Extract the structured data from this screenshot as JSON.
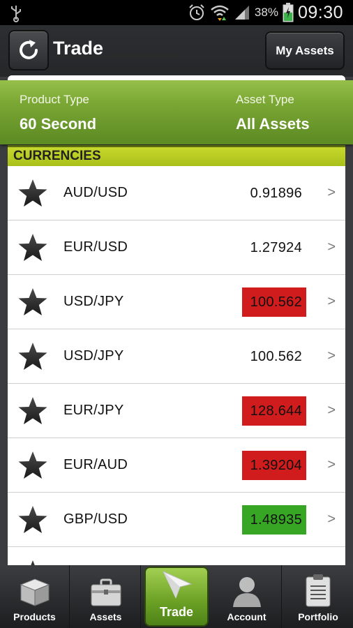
{
  "status_bar": {
    "battery_percent": "38%",
    "time": "09:30"
  },
  "header": {
    "title": "Trade",
    "my_assets_label": "My Assets"
  },
  "filters": {
    "product_type_label": "Product Type",
    "product_type_value": "60 Second",
    "asset_type_label": "Asset Type",
    "asset_type_value": "All Assets"
  },
  "section": {
    "title": "CURRENCIES"
  },
  "rows": [
    {
      "pair": "AUD/USD",
      "price": "0.91896",
      "state": "neutral"
    },
    {
      "pair": "EUR/USD",
      "price": "1.27924",
      "state": "neutral"
    },
    {
      "pair": "USD/JPY",
      "price": "100.562",
      "state": "down"
    },
    {
      "pair": "USD/JPY",
      "price": "100.562",
      "state": "neutral"
    },
    {
      "pair": "EUR/JPY",
      "price": "128.644",
      "state": "down"
    },
    {
      "pair": "EUR/AUD",
      "price": "1.39204",
      "state": "down"
    },
    {
      "pair": "GBP/USD",
      "price": "1.48935",
      "state": "up"
    }
  ],
  "row_chevron": ">",
  "nav": [
    {
      "label": "Products",
      "icon": "products-box-icon"
    },
    {
      "label": "Assets",
      "icon": "briefcase-icon"
    },
    {
      "label": "Trade",
      "icon": "paper-plane-icon",
      "active": true
    },
    {
      "label": "Account",
      "icon": "person-icon"
    },
    {
      "label": "Portfolio",
      "icon": "clipboard-icon"
    }
  ],
  "colors": {
    "accent_green": "#6aa024",
    "price_down": "#d01c1c",
    "price_up": "#37a624",
    "section_yellow": "#b4c61f"
  }
}
